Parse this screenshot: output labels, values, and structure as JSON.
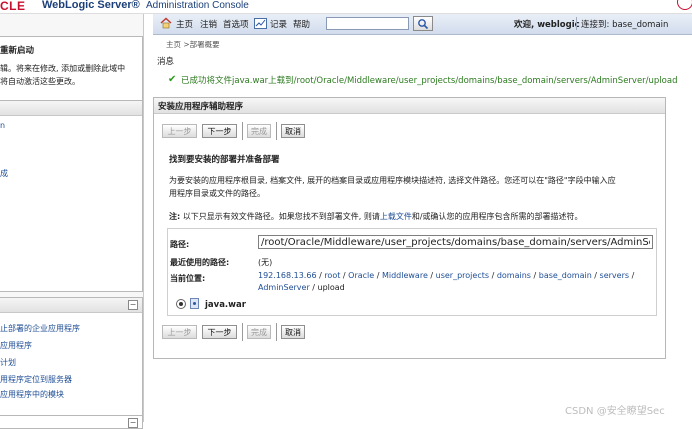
{
  "header": {
    "logo_fragment": "CLE",
    "product": "WebLogic Server®",
    "product_sub": "Administration Console"
  },
  "sidebar": {
    "change_center": {
      "button": "重新启动",
      "text_line1": "辑。将来在修改, 添加或删除此域中",
      "text_line2": "将自动激活这些更改。"
    },
    "domain_structure": {
      "items": [
        "n",
        "成"
      ]
    },
    "how_do_i": {
      "items": [
        "止部署的企业应用程序",
        "应用程序",
        "计划",
        "用程序定位到服务器",
        "应用程序中的模块"
      ]
    }
  },
  "nav": {
    "home": "主页",
    "logout": "注销",
    "preferences": "首选项",
    "record": "记录",
    "help": "帮助",
    "search_value": "",
    "welcome": "欢迎, weblogic",
    "connected": "连接到: base_domain"
  },
  "breadcrumb": "主页 >部署概要",
  "messages": {
    "title": "消息",
    "success": "已成功将文件java.war上载到/root/Oracle/Middleware/user_projects/domains/base_domain/servers/AdminServer/upload"
  },
  "panel": {
    "title": "安装应用程序辅助程序",
    "buttons": {
      "back": "上一步",
      "next": "下一步",
      "finish": "完成",
      "cancel": "取消"
    },
    "section_heading": "找到要安装的部署并准备部署",
    "desc_line1": "为要安装的应用程序根目录, 档案文件, 展开的档案目录或应用程序模块描述符, 选择文件路径。您还可以在\"路径\"字段中输入应",
    "desc_line2": "用程序目录或文件的路径。",
    "note_label": "注:",
    "note_text1": "以下只显示有效文件路径。如果您找不到部署文件, 则请",
    "note_link": "上载文件",
    "note_text2": "和/或确认您的应用程序包含所需的部署描述符。",
    "path_label": "路径:",
    "path_value": "/root/Oracle/Middleware/user_projects/domains/base_domain/servers/AdminServer/u",
    "recent_label": "最近使用的路径:",
    "recent_value": "(无)",
    "current_label": "当前位置:",
    "current_parts": [
      "192.168.13.66",
      "root",
      "Oracle",
      "Middleware",
      "user_projects",
      "domains",
      "base_domain",
      "servers"
    ],
    "current_line2_link": "AdminServer",
    "current_line2_tail": "upload",
    "file_name": "java.war"
  },
  "watermark": "CSDN @安全瞭望Sec",
  "colors": {
    "success_green": "#2c7a1f",
    "link_blue": "#1f4e96",
    "brand_red": "#c8102e"
  }
}
